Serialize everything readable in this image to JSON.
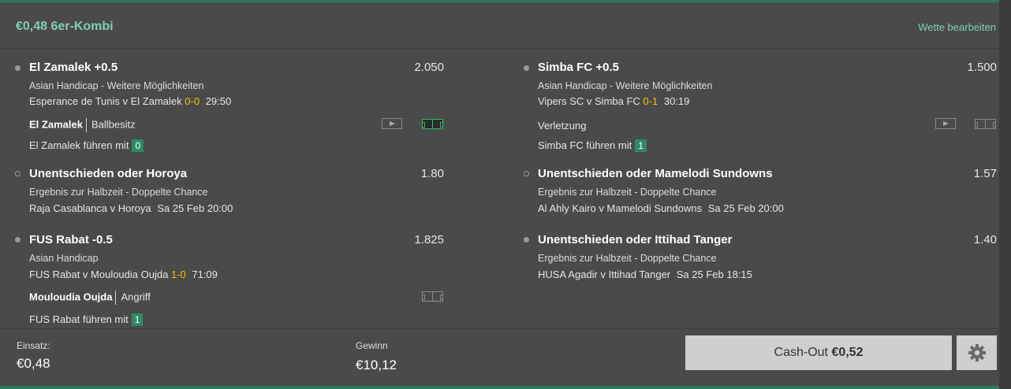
{
  "header": {
    "title": "€0,48 6er-Kombi",
    "edit_label": "Wette bearbeiten"
  },
  "bets": [
    {
      "selection": "El Zamalek +0.5",
      "odds": "2.050",
      "market": "Asian Handicap - Weitere Möglichkeiten",
      "match": "Esperance de Tunis v El Zamalek",
      "score": "0-0",
      "time": "29:50",
      "info_team": "El Zamalek",
      "info_text": "Ballbesitz",
      "lead_text": "El Zamalek führen mit",
      "lead_count": "0"
    },
    {
      "selection": "Simba FC +0.5",
      "odds": "1.500",
      "market": "Asian Handicap - Weitere Möglichkeiten",
      "match": "Vipers SC v Simba FC",
      "score": "0-1",
      "time": "30:19",
      "info_text": "Verletzung",
      "lead_text": "Simba FC führen mit",
      "lead_count": "1"
    },
    {
      "selection": "Unentschieden oder Horoya",
      "odds": "1.80",
      "market": "Ergebnis zur Halbzeit - Doppelte Chance",
      "match": "Raja Casablanca v Horoya",
      "date": "Sa 25 Feb 20:00"
    },
    {
      "selection": "Unentschieden oder Mamelodi Sundowns",
      "odds": "1.57",
      "market": "Ergebnis zur Halbzeit - Doppelte Chance",
      "match": "Al Ahly Kairo v Mamelodi Sundowns",
      "date": "Sa 25 Feb 20:00"
    },
    {
      "selection": "FUS Rabat -0.5",
      "odds": "1.825",
      "market": "Asian Handicap",
      "match": "FUS Rabat v Mouloudia Oujda",
      "score": "1-0",
      "time": "71:09",
      "info_team": "Mouloudia Oujda",
      "info_text": "Angriff",
      "lead_text": "FUS Rabat führen mit",
      "lead_count": "1"
    },
    {
      "selection": "Unentschieden oder Ittihad Tanger",
      "odds": "1.40",
      "market": "Ergebnis zur Halbzeit - Doppelte Chance",
      "match": "HUSA Agadir v Ittihad Tanger",
      "date": "Sa 25 Feb 18:15"
    }
  ],
  "footer": {
    "stake_label": "Einsatz:",
    "stake_value": "€0,48",
    "win_label": "Gewinn",
    "win_value": "€10,12",
    "cashout_label": "Cash-Out",
    "cashout_value": "€0,52"
  },
  "colors": {
    "accent": "#7fd1b0",
    "score": "#f0c400",
    "badge": "#2d8a66",
    "background": "#4a4a4a"
  }
}
